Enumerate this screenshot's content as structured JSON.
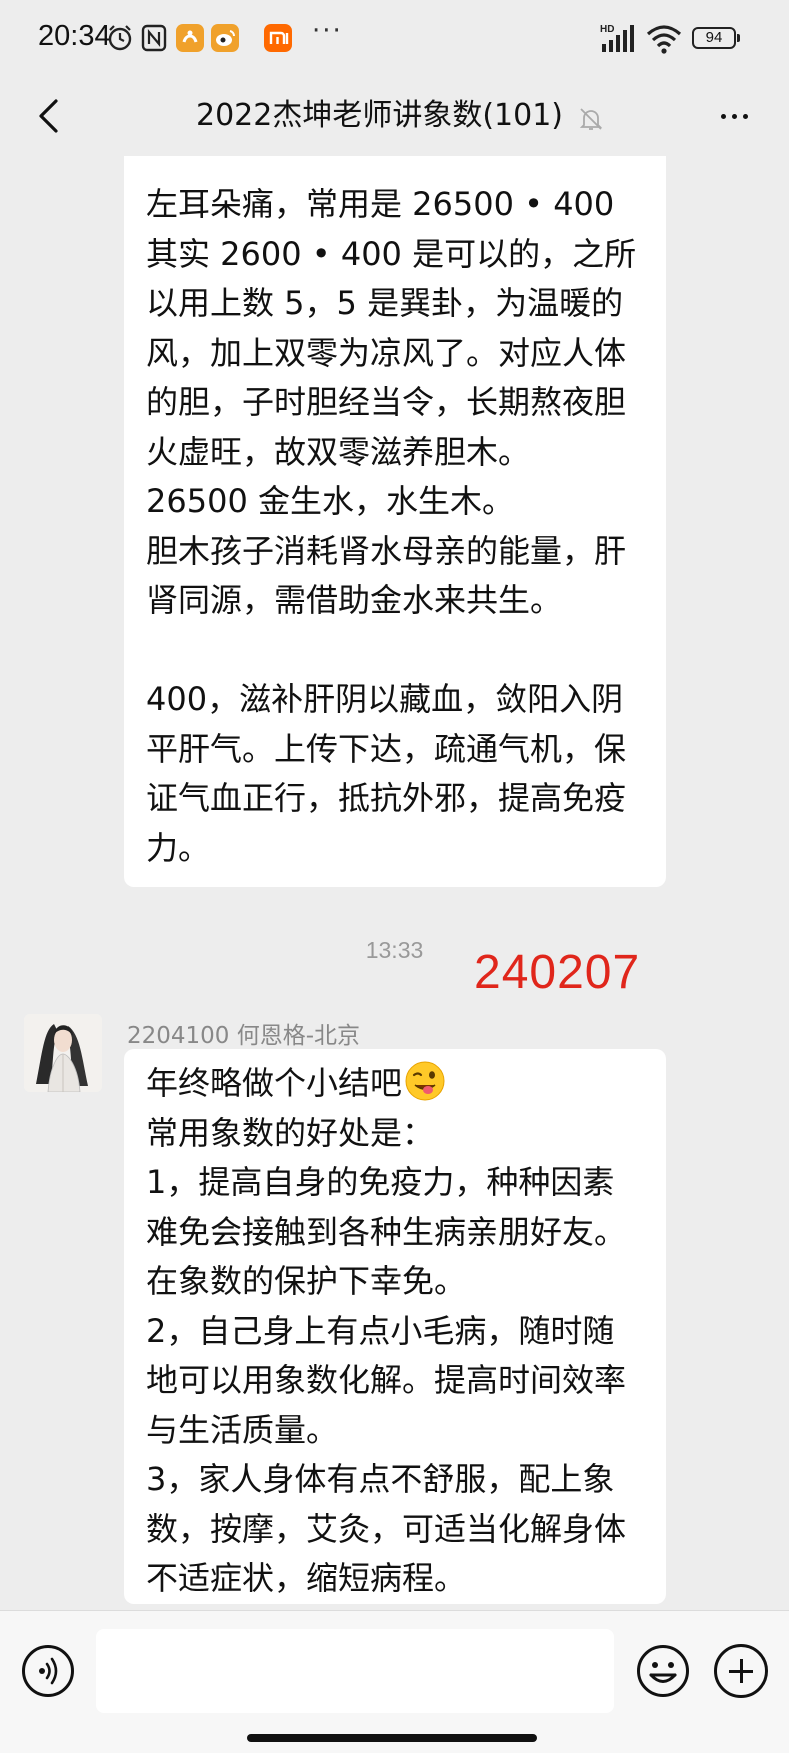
{
  "status_bar": {
    "time": "20:34",
    "more": "···",
    "network": "HD",
    "battery": "94"
  },
  "header": {
    "title": "2022杰坤老师讲象数(101)"
  },
  "messages": {
    "first": {
      "lines": [
        "左耳朵痛，常用是 26500 • 400",
        "其实 2600 • 400 是可以的，之所",
        "以用上数 5，5 是巽卦，为温暖的",
        "风，加上双零为凉风了。对应人体",
        "的胆，子时胆经当令，长期熬夜胆",
        "火虚旺，故双零滋养胆木。",
        "26500 金生水，水生木。",
        "胆木孩子消耗肾水母亲的能量，肝",
        "肾同源，需借助金水来共生。",
        " ",
        "400，滋补肝阴以藏血，敛阳入阴",
        "平肝气。上传下达，疏通气机，保",
        "证气血正行，抵抗外邪，提高免疫",
        "力。"
      ]
    },
    "timestamp": "13:33",
    "annotation": "240207",
    "second": {
      "sender": "2204100 何恩格-北京",
      "first_line": "年终略做个小结吧",
      "emoji": "wink-tongue-emoji",
      "lines": [
        "常用象数的好处是：",
        "1，提高自身的免疫力，种种因素",
        "难免会接触到各种生病亲朋好友。",
        "在象数的保护下幸免。",
        "2，自己身上有点小毛病，随时随",
        "地可以用象数化解。提高时间效率",
        "与生活质量。",
        "3，家人身体有点不舒服，配上象",
        "数，按摩，艾灸，可适当化解身体",
        "不适症状，缩短病程。"
      ]
    }
  },
  "input_bar": {
    "placeholder": ""
  },
  "colors": {
    "background": "#ededed",
    "bubble": "#ffffff",
    "annotation_red": "#e0261b",
    "muted_text": "#999999"
  }
}
